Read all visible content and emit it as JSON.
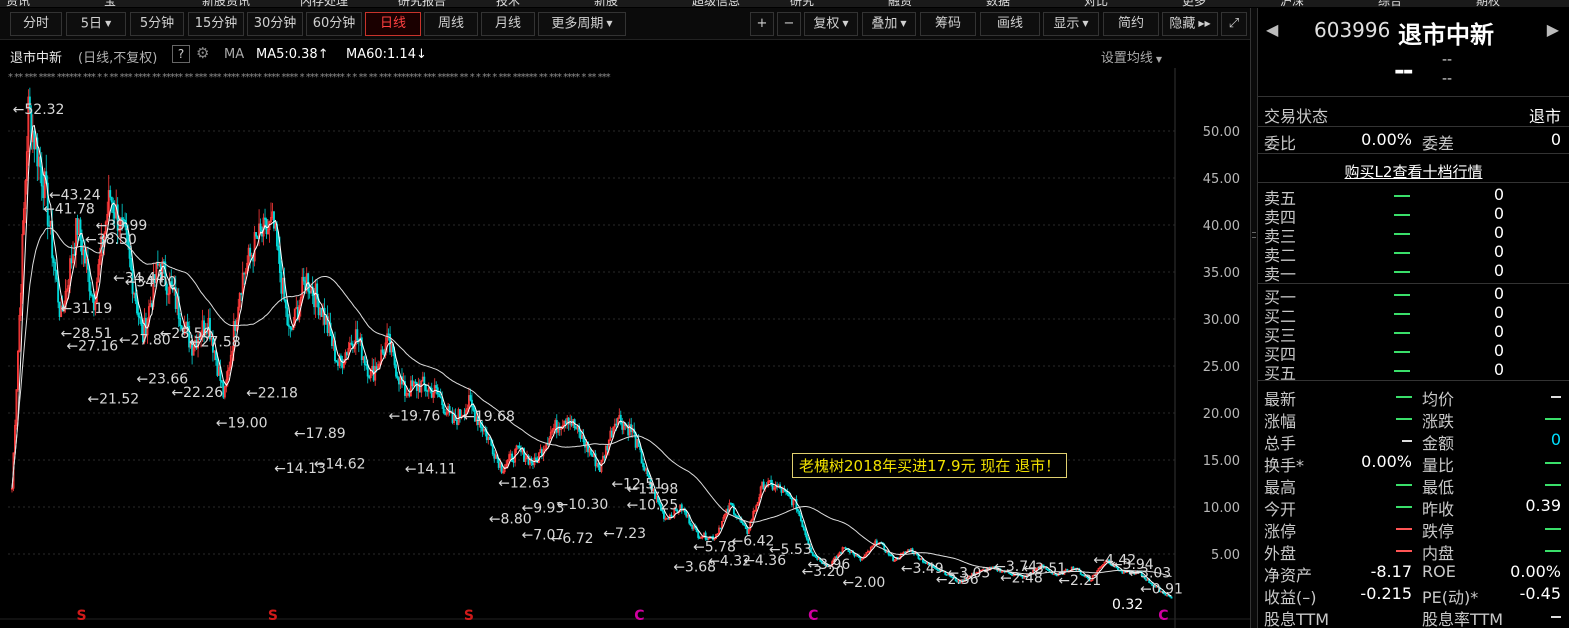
{
  "menu": [
    "资讯",
    "宝",
    "新股资讯",
    "内存处理",
    "研究报告",
    "技术",
    "新股",
    "超级信息",
    "研究",
    "融资",
    "数据",
    "对比",
    "更多",
    "沪深",
    "综合",
    "期权"
  ],
  "toolbar": {
    "periods": [
      "分时",
      "5日",
      "5分钟",
      "15分钟",
      "30分钟",
      "60分钟",
      "日线",
      "周线",
      "月线",
      "更多周期"
    ],
    "active_period": "日线",
    "right_buttons": [
      "+",
      "−",
      "复权",
      "叠加",
      "筹码",
      "画线",
      "显示",
      "简约",
      "隐藏",
      "⤢"
    ]
  },
  "chart_header": {
    "name": "退市中新",
    "kind": "(日线,不复权)",
    "help": "?",
    "ma_label": "MA",
    "ma5": "MA5:0.38",
    "ma5_arrow": "↑",
    "ma60": "MA60:1.14",
    "ma60_arrow": "↓",
    "set_ma": "设置均线"
  },
  "event_markers": "* ** *** **** ****** *** * * ** *** **** ** ***** ** *** *** **** ***** **** **** * *** ****** * * ** ** *** ******* *** ***** ** * * ** * *** ****** ** *** **** * ** ***",
  "annotation": "老槐树2018年买进17.9元 现在 退市！",
  "chart_data": {
    "type": "candlestick",
    "ylim": [
      0,
      55
    ],
    "y_ticks": [
      5,
      10,
      15,
      20,
      25,
      30,
      35,
      40,
      45,
      50
    ],
    "y_tick_labels": [
      "5.00",
      "10.00",
      "15.00",
      "20.00",
      "25.00",
      "30.00",
      "35.00",
      "40.00",
      "45.00",
      "50.00"
    ],
    "grid": true,
    "ma_lines": [
      {
        "name": "MA5",
        "value": 0.38
      },
      {
        "name": "MA60",
        "value": 1.14
      }
    ],
    "price_path": [
      12,
      52.32,
      44,
      30,
      40,
      32,
      43.24,
      38,
      28,
      36,
      32,
      27.16,
      30,
      21.52,
      34,
      38.5,
      39.99,
      28,
      34.44,
      31,
      25,
      28.5,
      24,
      27.58,
      22.26,
      23,
      22.18,
      19,
      21,
      17.89,
      14.13,
      16,
      14.62,
      18,
      19.76,
      17,
      14.11,
      19.68,
      18,
      12.63,
      8.8,
      9.93,
      7.07,
      6.72,
      10.3,
      7.23,
      12.51,
      11.98,
      10.25,
      5,
      3.68,
      5.78,
      4.32,
      6.42,
      4.36,
      5.53,
      3.96,
      3.2,
      2.0,
      3.0,
      3.49,
      3.03,
      2.5,
      3.74,
      2.7,
      3.6,
      2.21,
      4.42,
      3.04,
      3.03,
      1.5,
      0.32
    ],
    "annotations": [
      {
        "x": 0.004,
        "price": 52.32,
        "label": "←52.32"
      },
      {
        "x": 0.035,
        "price": 43.24,
        "label": "←43.24"
      },
      {
        "x": 0.03,
        "price": 41.78,
        "label": "←41.78"
      },
      {
        "x": 0.075,
        "price": 39.99,
        "label": "←39.99"
      },
      {
        "x": 0.066,
        "price": 38.5,
        "label": "←38.50"
      },
      {
        "x": 0.09,
        "price": 34.44,
        "label": "←34.44"
      },
      {
        "x": 0.1,
        "price": 34.0,
        "label": "←34.00"
      },
      {
        "x": 0.045,
        "price": 31.19,
        "label": "←31.19"
      },
      {
        "x": 0.045,
        "price": 28.51,
        "label": "←28.51"
      },
      {
        "x": 0.05,
        "price": 27.16,
        "label": "←27.16"
      },
      {
        "x": 0.095,
        "price": 27.8,
        "label": "←27.80"
      },
      {
        "x": 0.13,
        "price": 28.5,
        "label": "←28.50"
      },
      {
        "x": 0.155,
        "price": 27.58,
        "label": "←27.58"
      },
      {
        "x": 0.11,
        "price": 23.66,
        "label": "←23.66"
      },
      {
        "x": 0.068,
        "price": 21.52,
        "label": "←21.52"
      },
      {
        "x": 0.14,
        "price": 22.26,
        "label": "←22.26"
      },
      {
        "x": 0.204,
        "price": 22.18,
        "label": "←22.18"
      },
      {
        "x": 0.178,
        "price": 19.0,
        "label": "←19.00"
      },
      {
        "x": 0.245,
        "price": 17.89,
        "label": "←17.89"
      },
      {
        "x": 0.228,
        "price": 14.13,
        "label": "←14.13"
      },
      {
        "x": 0.262,
        "price": 14.62,
        "label": "←14.62"
      },
      {
        "x": 0.326,
        "price": 19.76,
        "label": "←19.76"
      },
      {
        "x": 0.34,
        "price": 14.11,
        "label": "←14.11"
      },
      {
        "x": 0.39,
        "price": 19.68,
        "label": "←19.68"
      },
      {
        "x": 0.42,
        "price": 12.63,
        "label": "←12.63"
      },
      {
        "x": 0.412,
        "price": 8.8,
        "label": "←8.80"
      },
      {
        "x": 0.44,
        "price": 9.93,
        "label": "←9.93"
      },
      {
        "x": 0.44,
        "price": 7.07,
        "label": "←7.07"
      },
      {
        "x": 0.465,
        "price": 6.72,
        "label": "←6.72"
      },
      {
        "x": 0.47,
        "price": 10.3,
        "label": "←10.30"
      },
      {
        "x": 0.51,
        "price": 7.23,
        "label": "←7.23"
      },
      {
        "x": 0.517,
        "price": 12.51,
        "label": "←12.51"
      },
      {
        "x": 0.53,
        "price": 11.98,
        "label": "←11.98"
      },
      {
        "x": 0.53,
        "price": 10.25,
        "label": "←10.25"
      },
      {
        "x": 0.57,
        "price": 3.68,
        "label": "←3.68"
      },
      {
        "x": 0.587,
        "price": 5.78,
        "label": "←5.78"
      },
      {
        "x": 0.6,
        "price": 4.32,
        "label": "←4.32"
      },
      {
        "x": 0.62,
        "price": 6.42,
        "label": "←6.42"
      },
      {
        "x": 0.63,
        "price": 4.36,
        "label": "←4.36"
      },
      {
        "x": 0.652,
        "price": 5.53,
        "label": "←5.53"
      },
      {
        "x": 0.685,
        "price": 3.96,
        "label": "←3.96"
      },
      {
        "x": 0.68,
        "price": 3.2,
        "label": "←3.20"
      },
      {
        "x": 0.715,
        "price": 2.0,
        "label": "←2.00"
      },
      {
        "x": 0.765,
        "price": 3.49,
        "label": "←3.49"
      },
      {
        "x": 0.805,
        "price": 3.03,
        "label": "←3.03"
      },
      {
        "x": 0.795,
        "price": 2.36,
        "label": "←2.36"
      },
      {
        "x": 0.845,
        "price": 3.74,
        "label": "←3.74"
      },
      {
        "x": 0.85,
        "price": 2.48,
        "label": "←2.48"
      },
      {
        "x": 0.87,
        "price": 3.51,
        "label": "←3.51"
      },
      {
        "x": 0.9,
        "price": 2.21,
        "label": "←2.21"
      },
      {
        "x": 0.93,
        "price": 4.42,
        "label": "←4.42"
      },
      {
        "x": 0.945,
        "price": 3.94,
        "label": "←3.94"
      },
      {
        "x": 0.96,
        "price": 3.03,
        "label": "←3.03"
      },
      {
        "x": 0.97,
        "price": 1.31,
        "label": "←0.91"
      }
    ],
    "last_label": "0.32",
    "bottom_markers": [
      {
        "x": 0.063,
        "label": "S",
        "color": "#d01a1a"
      },
      {
        "x": 0.227,
        "label": "S",
        "color": "#d01a1a"
      },
      {
        "x": 0.395,
        "label": "S",
        "color": "#d01a1a"
      },
      {
        "x": 0.541,
        "label": "C",
        "color": "#d000a0"
      },
      {
        "x": 0.69,
        "label": "C",
        "color": "#d000a0"
      },
      {
        "x": 0.99,
        "label": "C",
        "color": "#d000a0"
      }
    ]
  },
  "side": {
    "nav_left": "◀",
    "nav_right": "▶",
    "code": "603996",
    "name": "退市中新",
    "price": "--",
    "change": "--",
    "change_pct": "--",
    "status_label": "交易状态",
    "status_value": "退市",
    "weibi_label": "委比",
    "weibi_value": "0.00%",
    "weicha_label": "委差",
    "weicha_value": "0",
    "buy_l2": "购买L2查看十档行情",
    "sell": [
      {
        "label": "卖五",
        "volume": "0"
      },
      {
        "label": "卖四",
        "volume": "0"
      },
      {
        "label": "卖三",
        "volume": "0"
      },
      {
        "label": "卖二",
        "volume": "0"
      },
      {
        "label": "卖一",
        "volume": "0"
      }
    ],
    "buy": [
      {
        "label": "买一",
        "volume": "0"
      },
      {
        "label": "买二",
        "volume": "0"
      },
      {
        "label": "买三",
        "volume": "0"
      },
      {
        "label": "买四",
        "volume": "0"
      },
      {
        "label": "买五",
        "volume": "0"
      }
    ],
    "stats": [
      {
        "l1": "最新",
        "v1": "",
        "l2": "均价",
        "v2": ""
      },
      {
        "l1": "涨幅",
        "v1": "",
        "l2": "涨跌",
        "v2": ""
      },
      {
        "l1": "总手",
        "v1": "",
        "l2": "金额",
        "v2": "0"
      },
      {
        "l1": "换手*",
        "v1": "0.00%",
        "l2": "量比",
        "v2": ""
      },
      {
        "l1": "最高",
        "v1": "",
        "l2": "最低",
        "v2": ""
      },
      {
        "l1": "今开",
        "v1": "",
        "l2": "昨收",
        "v2": "0.39"
      },
      {
        "l1": "涨停",
        "v1": "",
        "l2": "跌停",
        "v2": ""
      },
      {
        "l1": "外盘",
        "v1": "",
        "l2": "内盘",
        "v2": ""
      },
      {
        "l1": "净资产",
        "v1": "-8.17",
        "l2": "ROE",
        "v2": "0.00%"
      },
      {
        "l1": "收益(–)",
        "v1": "-0.215",
        "l2": "PE(动)*",
        "v2": "-0.45"
      },
      {
        "l1": "股息TTM",
        "v1": "",
        "l2": "股息率TTM",
        "v2": ""
      }
    ]
  }
}
